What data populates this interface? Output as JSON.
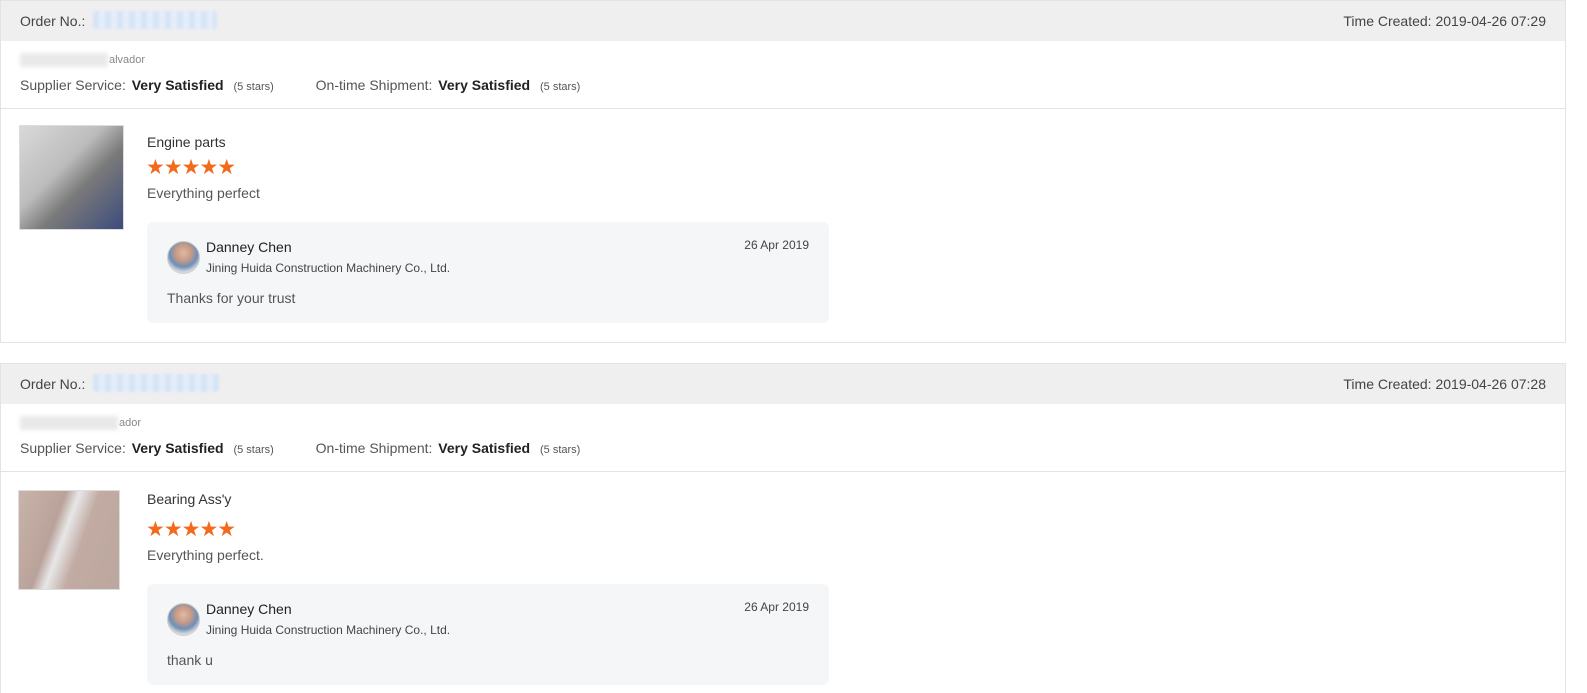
{
  "orders": [
    {
      "order_no_label": "Order No.:",
      "time_created": "Time Created: 2019-04-26 07:29",
      "buyer_suffix": "alvador",
      "supplier_service_label": "Supplier Service:",
      "supplier_service_value": "Very Satisfied",
      "supplier_service_stars": "(5 stars)",
      "shipment_label": "On-time Shipment:",
      "shipment_value": "Very Satisfied",
      "shipment_stars": "(5 stars)",
      "product_name": "Engine parts",
      "rating": 5,
      "star_glyphs": "★★★★★",
      "review_text": "Everything perfect",
      "reply": {
        "name": "Danney Chen",
        "company": "Jining Huida Construction Machinery Co., Ltd.",
        "date": "26 Apr 2019",
        "text": "Thanks for your trust"
      }
    },
    {
      "order_no_label": "Order No.:",
      "time_created": "Time Created: 2019-04-26 07:28",
      "buyer_suffix": "ador",
      "supplier_service_label": "Supplier Service:",
      "supplier_service_value": "Very Satisfied",
      "supplier_service_stars": "(5 stars)",
      "shipment_label": "On-time Shipment:",
      "shipment_value": "Very Satisfied",
      "shipment_stars": "(5 stars)",
      "product_name": "Bearing Ass'y",
      "rating": 5,
      "star_glyphs": "★★★★★",
      "review_text": "Everything perfect.",
      "reply": {
        "name": "Danney Chen",
        "company": "Jining Huida Construction Machinery Co., Ltd.",
        "date": "26 Apr 2019",
        "text": "thank u"
      }
    }
  ],
  "colors": {
    "star": "#f26a1b",
    "header_bg": "#efefef",
    "reply_bg": "#f5f6f8"
  }
}
